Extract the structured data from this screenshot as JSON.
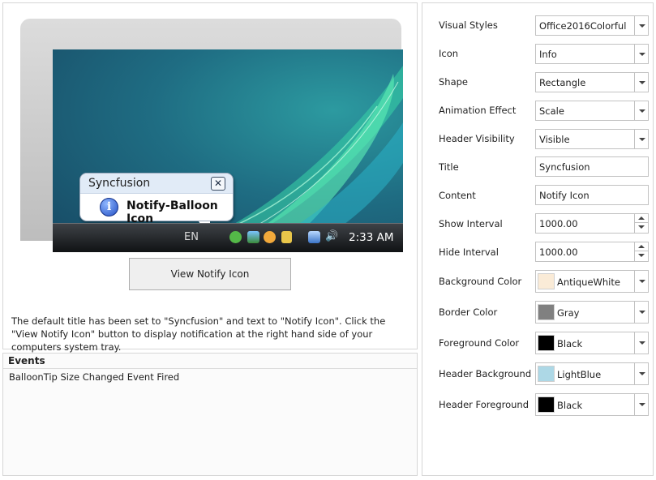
{
  "preview": {
    "balloon_title": "Syncfusion",
    "balloon_close": "✕",
    "balloon_icon_glyph": "i",
    "balloon_text": "Notify-Balloon Icon",
    "taskbar_lang": "EN",
    "taskbar_clock": "2:33 AM"
  },
  "actions": {
    "view_notify_label": "View Notify Icon"
  },
  "description": "The default title has been set to \"Syncfusion\" and text to \"Notify Icon\". Click the \"View Notify Icon\" button to display notification at the right hand side of your computers system tray.",
  "events": {
    "title": "Events",
    "items": [
      "BalloonTip Size Changed Event Fired"
    ]
  },
  "properties": {
    "visual_styles": {
      "label": "Visual Styles",
      "value": "Office2016Colorful"
    },
    "icon": {
      "label": "Icon",
      "value": "Info"
    },
    "shape": {
      "label": "Shape",
      "value": "Rectangle"
    },
    "animation_effect": {
      "label": "Animation Effect",
      "value": "Scale"
    },
    "header_visibility": {
      "label": "Header Visibility",
      "value": "Visible"
    },
    "title": {
      "label": "Title",
      "value": "Syncfusion"
    },
    "content": {
      "label": "Content",
      "value": "Notify Icon"
    },
    "show_interval": {
      "label": "Show Interval",
      "value": "1000.00"
    },
    "hide_interval": {
      "label": "Hide Interval",
      "value": "1000.00"
    },
    "background_color": {
      "label": "Background Color",
      "value": "AntiqueWhite",
      "swatch": "#FAEBD7"
    },
    "border_color": {
      "label": "Border Color",
      "value": "Gray",
      "swatch": "#808080"
    },
    "foreground_color": {
      "label": "Foreground Color",
      "value": "Black",
      "swatch": "#000000"
    },
    "header_background": {
      "label": "Header Background",
      "value": "LightBlue",
      "swatch": "#ADD8E6"
    },
    "header_foreground": {
      "label": "Header Foreground",
      "value": "Black",
      "swatch": "#000000"
    }
  }
}
